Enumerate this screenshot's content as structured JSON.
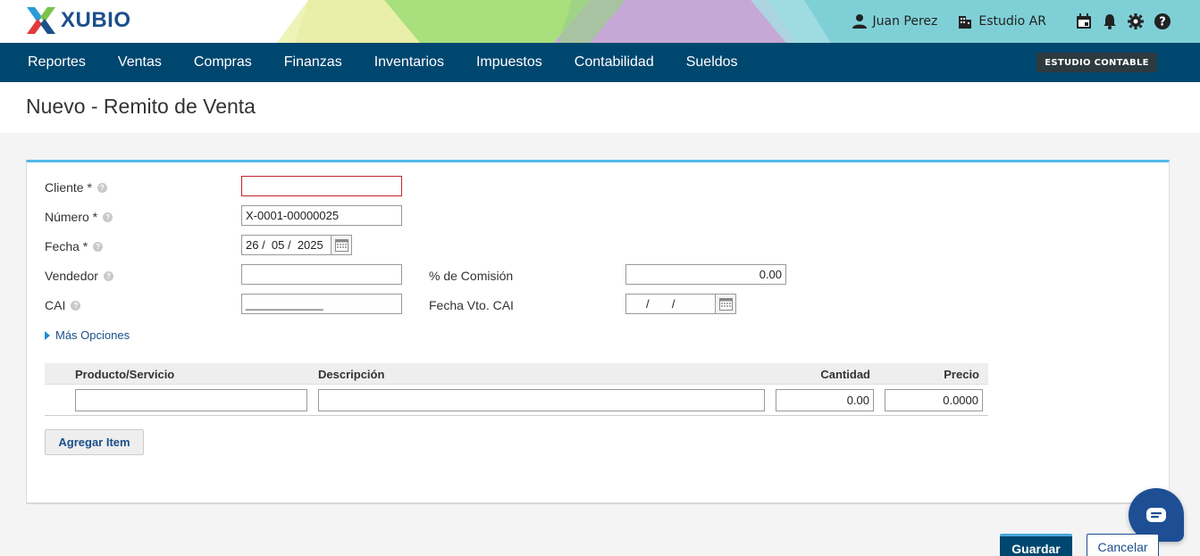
{
  "header": {
    "logo_text": "XUBIO",
    "user_name": "Juan Perez",
    "company": "Estudio AR",
    "icons": [
      "user-icon",
      "building-icon",
      "calendar-icon",
      "bell-icon",
      "gear-icon",
      "help-icon"
    ]
  },
  "nav": {
    "items": [
      "Reportes",
      "Ventas",
      "Compras",
      "Finanzas",
      "Inventarios",
      "Impuestos",
      "Contabilidad",
      "Sueldos"
    ],
    "studio_button": "ESTUDIO CONTABLE"
  },
  "page": {
    "title": "Nuevo - Remito de Venta"
  },
  "form": {
    "cliente_label": "Cliente *",
    "cliente_value": "",
    "numero_label": "Número *",
    "numero_value": "X-0001-00000025",
    "fecha_label": "Fecha *",
    "fecha_value": "26 /  05 /  2025",
    "vendedor_label": "Vendedor",
    "vendedor_value": "",
    "comision_label": "% de Comisión",
    "comision_value": "0.00",
    "cai_label": "CAI",
    "cai_value": "____________",
    "fecha_vto_label": "Fecha Vto. CAI",
    "fecha_vto_value": "/       /",
    "more_options": "Más Opciones"
  },
  "items_table": {
    "columns": [
      "Producto/Servicio",
      "Descripción",
      "Cantidad",
      "Precio"
    ],
    "rows": [
      {
        "producto": "",
        "descripcion": "",
        "cantidad": "0.00",
        "precio": "0.0000"
      }
    ],
    "add_button": "Agregar Item"
  },
  "actions": {
    "save": "Guardar",
    "cancel": "Cancelar"
  },
  "colors": {
    "nav_bg": "#00476f",
    "accent": "#55b9e8",
    "error": "#c0262d"
  }
}
